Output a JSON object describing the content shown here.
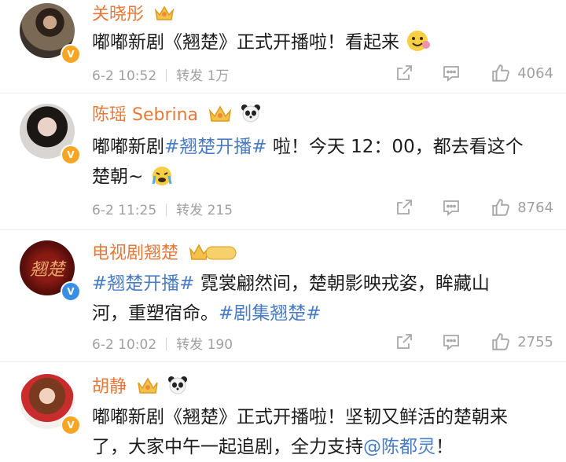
{
  "posts": [
    {
      "username": "关晓彤",
      "badge": "v-orange",
      "content": [
        "嘟嘟新剧《翘楚》正式开播啦！看起来"
      ],
      "date": "6-2 10:52",
      "repost": "转发 1万",
      "likes": "4064"
    },
    {
      "username": "陈瑶 Sebrina",
      "badge": "v-orange",
      "content_prefix": "嘟嘟新剧",
      "hashtag": "#翘楚开播#",
      "content_suffix": " 啦！今天 12：00，都去看这个",
      "content_line2": "楚朝~",
      "date": "6-2 11:25",
      "repost": "转发 215",
      "likes": "8764"
    },
    {
      "username": "电视剧翘楚",
      "badge": "v-blue",
      "level": "I",
      "hashtag1": "#翘楚开播#",
      "content_mid": " 霓裳翩然间，楚朝影映戎姿，眸藏山",
      "content_line2_prefix": "河，重塑宿命。",
      "hashtag2": "#剧集翘楚#",
      "date": "6-2 10:02",
      "repost": "转发 190",
      "likes": "2755"
    },
    {
      "username": "胡静",
      "badge": "v-orange",
      "content_line1": "嘟嘟新剧《翘楚》正式开播啦！坚韧又鲜活的楚朝来",
      "content_line2_prefix": "了，大家中午一起追剧，全力支持",
      "mention": "@陈都灵",
      "content_line2_suffix": "！"
    }
  ],
  "icons": {
    "share": "share-icon",
    "comment": "comment-icon",
    "like": "thumbs-up-icon",
    "crown": "crown-icon",
    "panda": "panda-icon"
  },
  "colors": {
    "username": "#e5793a",
    "link": "#4a7cc4",
    "meta": "#a0a0a0"
  }
}
